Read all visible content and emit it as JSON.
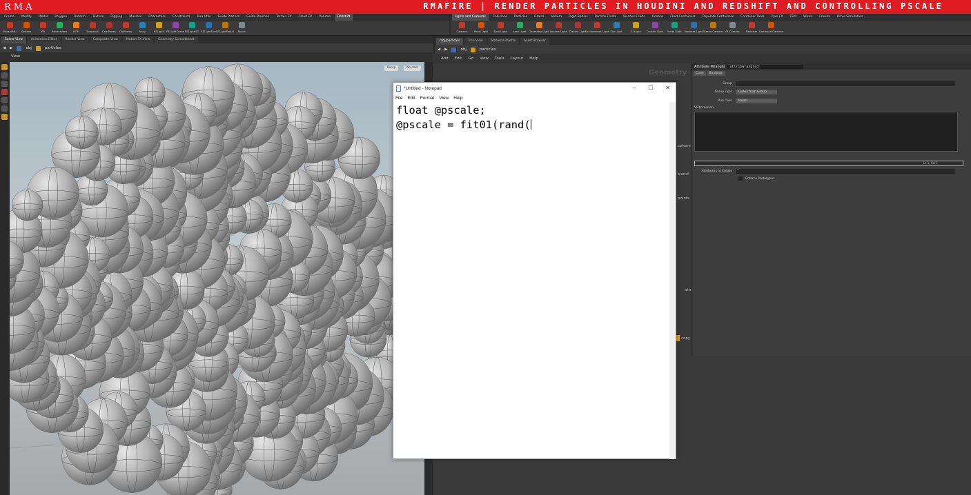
{
  "banner": {
    "brand": "RMA",
    "title": "RMAFIRE | RENDER PARTICLES IN HOUDINI AND REDSHIFT AND CONTROLLING PSCALE",
    "color": "#e01b22"
  },
  "shelf_left": {
    "tabs": [
      "Create",
      "Modify",
      "Model",
      "Polygon",
      "Deform",
      "Texture",
      "Rigging",
      "Muscles",
      "Characters",
      "Constraints",
      "Run Utils",
      "Guide Process",
      "Guide Brushes",
      "Terrain FX",
      "Cloud FX",
      "Volume",
      "Redshift"
    ],
    "active_tab": "Redshift",
    "tools": [
      "RedshiftRI",
      "Options",
      "IPR",
      "RenderView",
      "ROP",
      "Snapshot",
      "CamParms",
      "ObjParms",
      "Proxy",
      "RSLight",
      "RSLightDome",
      "RSLightIES",
      "RSLightSun",
      "RSLightPortal",
      "About"
    ]
  },
  "shelf_right": {
    "tabs": [
      "Lights and Cameras",
      "Collisions",
      "Particles",
      "Grains",
      "Vellum",
      "Rigid Bodies",
      "Particle Fluids",
      "Viscous Fluids",
      "Oceans",
      "Fluid Containers",
      "Populate Containers",
      "Container Tools",
      "Pyro FX",
      "FEM",
      "Wires",
      "Crowds",
      "Drive Simulation"
    ],
    "active_tab": "Lights and Cameras",
    "tools": [
      "Camera",
      "Point Light",
      "Spot Light",
      "Area Light",
      "Geometry Light",
      "Volume Light",
      "Distant Light",
      "Environment Light",
      "Sky Light",
      "GI Light",
      "Caustic Light",
      "Portal Light",
      "Ambient Light",
      "Stereo Camera",
      "VR Camera",
      "Switcher",
      "Gamepad Camera"
    ]
  },
  "left_pane": {
    "tabs": [
      "Scene View",
      "Animation Editor",
      "Render View",
      "Composite View",
      "Motion FX View",
      "Geometry Spreadsheet"
    ],
    "active_tab": "Scene View",
    "path": [
      "obj",
      "particles"
    ],
    "view_label": "View",
    "persp_label": "Persp",
    "cam_label": "No cam"
  },
  "right_pane": {
    "tabs": [
      "/obj/particles",
      "Tree View",
      "Material Palette",
      "Asset Browser"
    ],
    "active_tab": "/obj/particles",
    "path": [
      "obj",
      "particles"
    ],
    "menu": [
      "Add",
      "Edit",
      "Go",
      "View",
      "Tools",
      "Layout",
      "Help"
    ],
    "context_label": "Geometry",
    "nodes": [
      "sphere",
      "transf",
      "points",
      "attr",
      "copy"
    ]
  },
  "params": {
    "node_type": "Attribute Wrangle",
    "node_name": "attribwrangle3",
    "tabs": [
      "Code",
      "Bindings"
    ],
    "group_label": "Group",
    "group_type_label": "Group Type",
    "group_type_value": "Guess from Group",
    "run_over_label": "Run Over",
    "run_over_value": "Points",
    "vex_label": "VEXpression",
    "cursor_pos": "Ln 1, Col 1",
    "attr_create_label": "Attributes to Create",
    "attr_create_value": "*",
    "enforce_label": "Enforce Prototypes"
  },
  "notepad": {
    "title": "*Untitled - Notepad",
    "menu": [
      "File",
      "Edit",
      "Format",
      "View",
      "Help"
    ],
    "line1": "float @pscale;",
    "line2": "@pscale = fit01(rand("
  }
}
